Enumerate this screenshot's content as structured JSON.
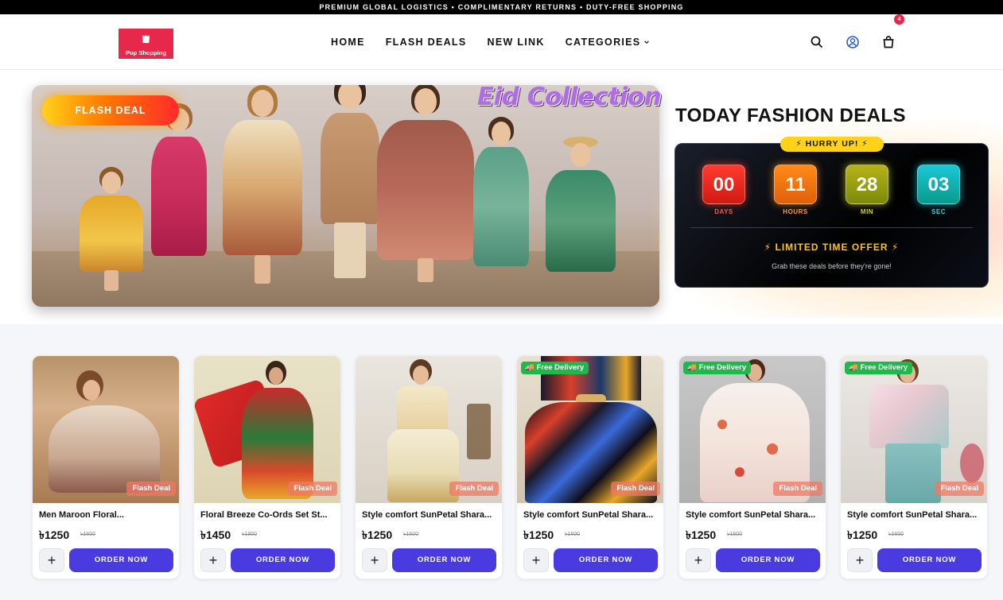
{
  "topbar": {
    "text": "PREMIUM GLOBAL LOGISTICS • COMPLIMENTARY RETURNS • DUTY-FREE SHOPPING"
  },
  "header": {
    "logo_text": "Pop Shopping",
    "nav": [
      {
        "label": "HOME"
      },
      {
        "label": "FLASH DEALS"
      },
      {
        "label": "NEW LINK"
      },
      {
        "label": "CATEGORIES"
      }
    ],
    "icons": [
      "search-icon",
      "user-icon",
      "cart-icon"
    ],
    "cart_count": "4"
  },
  "hero": {
    "flash_badge": "FLASH DEAL",
    "banner_title": "Eid Collection"
  },
  "deals": {
    "title": "TODAY FASHION DEALS",
    "hurry": "⚡ HURRY UP! ⚡",
    "timer": [
      {
        "value": "00",
        "label": "DAYS"
      },
      {
        "value": "11",
        "label": "HOURS"
      },
      {
        "value": "28",
        "label": "MIN"
      },
      {
        "value": "03",
        "label": "SEC"
      }
    ],
    "offer": "LIMITED TIME OFFER",
    "offer_sub": "Grab these deals before they're gone!"
  },
  "products": [
    {
      "title": "Men Maroon Floral...",
      "price": "৳1250",
      "old_price": "৳1600",
      "tag": "Flash Deal",
      "free_delivery": "",
      "order_label": "ORDER NOW"
    },
    {
      "title": "Floral Breeze Co-Ords Set St...",
      "price": "৳1450",
      "old_price": "৳1800",
      "tag": "Flash Deal",
      "free_delivery": "",
      "order_label": "ORDER NOW"
    },
    {
      "title": "Style comfort SunPetal Shara...",
      "price": "৳1250",
      "old_price": "৳1600",
      "tag": "Flash Deal",
      "free_delivery": "",
      "order_label": "ORDER NOW"
    },
    {
      "title": "Style comfort SunPetal Shara...",
      "price": "৳1250",
      "old_price": "৳1600",
      "tag": "Flash Deal",
      "free_delivery": "🚚 Free Delivery",
      "order_label": "ORDER NOW"
    },
    {
      "title": "Style comfort SunPetal Shara...",
      "price": "৳1250",
      "old_price": "৳1600",
      "tag": "Flash Deal",
      "free_delivery": "🚚 Free Delivery",
      "order_label": "ORDER NOW"
    },
    {
      "title": "Style comfort SunPetal Shara...",
      "price": "৳1250",
      "old_price": "৳1600",
      "tag": "Flash Deal",
      "free_delivery": "🚚 Free Delivery",
      "order_label": "ORDER NOW"
    }
  ],
  "colors": {
    "brand": "#e8284a",
    "button": "#4a3be0",
    "free_delivery": "#1fb84a",
    "hurry": "#ffd21a"
  }
}
